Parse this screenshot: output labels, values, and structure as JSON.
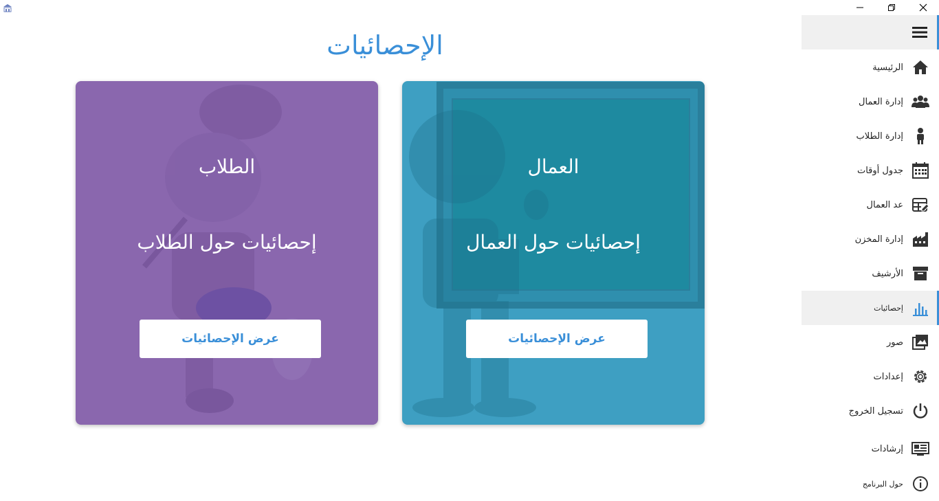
{
  "window": {
    "controls": [
      "minimize",
      "restore",
      "close"
    ]
  },
  "page": {
    "title": "الإحصائيات"
  },
  "cards": {
    "workers": {
      "title": "العمال",
      "subtitle": "إحصائيات حول العمال",
      "button": "عرض الإحصائيات",
      "color": "#3e9fc2"
    },
    "students": {
      "title": "الطلاب",
      "subtitle": "إحصائيات حول الطلاب",
      "button": "عرض الإحصائيات",
      "color": "#8a67ae"
    }
  },
  "sidebar": {
    "accent": "#3a8fd8",
    "items": [
      {
        "label": "الرئيسية",
        "icon": "home-icon"
      },
      {
        "label": "إدارة العمال",
        "icon": "users-icon"
      },
      {
        "label": "إدارة الطلاب",
        "icon": "child-icon"
      },
      {
        "label": "جدول أوقات",
        "icon": "calendar-icon"
      },
      {
        "label": "عد العمال",
        "icon": "table-edit-icon"
      },
      {
        "label": "إدارة المخزن",
        "icon": "factory-icon"
      },
      {
        "label": "الأرشيف",
        "icon": "archive-icon"
      },
      {
        "label": "إحصائيات",
        "icon": "bar-chart-icon",
        "active": true
      },
      {
        "label": "صور",
        "icon": "image-icon"
      },
      {
        "label": "إعدادات",
        "icon": "gear-icon"
      },
      {
        "label": "تسجيل الخروج",
        "icon": "power-icon"
      },
      {
        "label": "إرشادات",
        "icon": "guide-icon"
      },
      {
        "label": "حول البرنامج",
        "icon": "info-icon"
      }
    ]
  }
}
